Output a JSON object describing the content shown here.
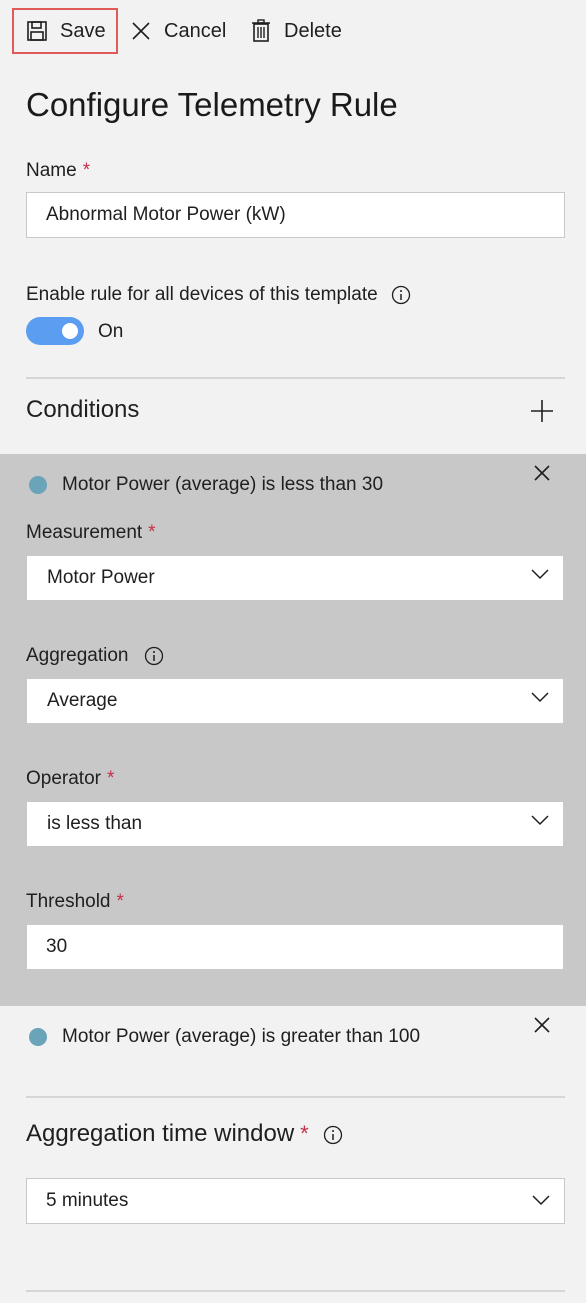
{
  "toolbar": {
    "save_label": "Save",
    "cancel_label": "Cancel",
    "delete_label": "Delete"
  },
  "page_title": "Configure Telemetry Rule",
  "name_field": {
    "label": "Name",
    "required_mark": "*",
    "value": "Abnormal Motor Power (kW)"
  },
  "enable_rule": {
    "label": "Enable rule for all devices of this template",
    "toggle_state_label": "On",
    "toggle_on": true
  },
  "conditions": {
    "heading": "Conditions",
    "items": [
      {
        "summary": "Motor Power (average) is less than 30",
        "expanded": true,
        "measurement": {
          "label": "Measurement",
          "required_mark": "*",
          "value": "Motor Power"
        },
        "aggregation": {
          "label": "Aggregation",
          "value": "Average"
        },
        "operator": {
          "label": "Operator",
          "required_mark": "*",
          "value": "is less than"
        },
        "threshold": {
          "label": "Threshold",
          "required_mark": "*",
          "value": "30"
        }
      },
      {
        "summary": "Motor Power (average) is greater than 100",
        "expanded": false
      }
    ]
  },
  "aggregation_window": {
    "label": "Aggregation time window",
    "required_mark": "*",
    "value": "5 minutes"
  },
  "colors": {
    "accent_toggle": "#5b9df0",
    "required": "#c4314b",
    "condition_dot": "#6aa4b8",
    "highlight_border": "#e05a5a",
    "panel_bg": "#c8c8c8"
  }
}
